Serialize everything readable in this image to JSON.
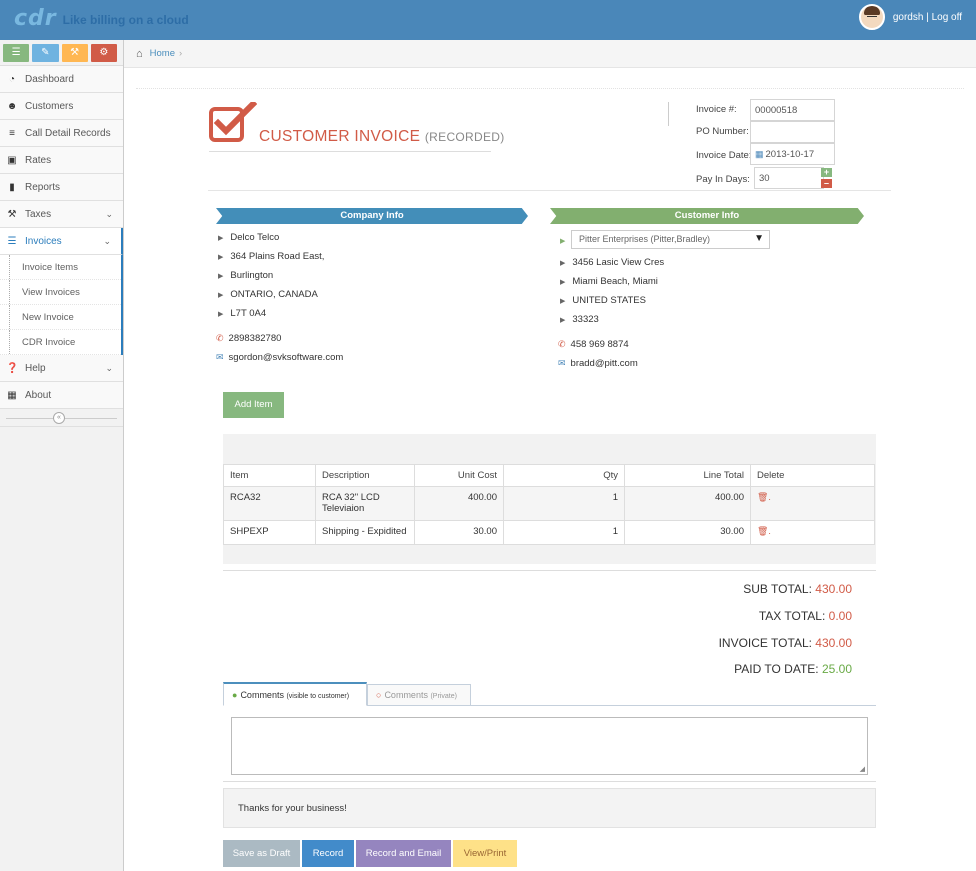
{
  "header": {
    "logo_text": "cdr",
    "tagline": "Like billing on a cloud",
    "username": "gordsh",
    "separator": "|",
    "logoff": "Log off"
  },
  "sidebar": {
    "items": [
      {
        "label": "Dashboard",
        "icon": "tachometer-icon"
      },
      {
        "label": "Customers",
        "icon": "users-icon"
      },
      {
        "label": "Call Detail Records",
        "icon": "list-icon"
      },
      {
        "label": "Rates",
        "icon": "money-icon"
      },
      {
        "label": "Reports",
        "icon": "file-icon"
      },
      {
        "label": "Taxes",
        "icon": "gavel-icon"
      },
      {
        "label": "Invoices",
        "icon": "list-icon"
      },
      {
        "label": "Help",
        "icon": "question-icon"
      },
      {
        "label": "About",
        "icon": "building-icon"
      }
    ],
    "invoices_sub": [
      "Invoice Items",
      "View Invoices",
      "New Invoice",
      "CDR Invoice"
    ]
  },
  "breadcrumb": {
    "home": "Home"
  },
  "invoice": {
    "title": "CUSTOMER INVOICE",
    "status": "(RECORDED)",
    "number_label": "Invoice #:",
    "number": "00000518",
    "po_label": "PO Number:",
    "po_value": "",
    "date_label": "Invoice Date:",
    "date": "2013-10-17",
    "pay_label": "Pay In Days:",
    "pay_days": "30"
  },
  "company": {
    "heading": "Company Info",
    "name": "Delco Telco",
    "address1": "364 Plains Road East,",
    "city": "Burlington",
    "region": "ONTARIO, CANADA",
    "postal": "L7T 0A4",
    "phone": "2898382780",
    "email": "sgordon@svksoftware.com"
  },
  "customer": {
    "heading": "Customer Info",
    "selected": "Pitter Enterprises (Pitter,Bradley)",
    "address1": "3456 Lasic View Cres",
    "city": "Miami Beach, Miami",
    "country": "UNITED STATES",
    "postal": "33323",
    "phone": "458 969 8874",
    "email": "bradd@pitt.com"
  },
  "add_item_label": "Add Item",
  "table": {
    "headers": [
      "Item",
      "Description",
      "Unit Cost",
      "Qty",
      "Line Total",
      "Delete"
    ],
    "rows": [
      {
        "item": "RCA32",
        "description": "RCA 32\" LCD Televiaion",
        "unit_cost": "400.00",
        "qty": "1",
        "line_total": "400.00"
      },
      {
        "item": "SHPEXP",
        "description": "Shipping - Expidited",
        "unit_cost": "30.00",
        "qty": "1",
        "line_total": "30.00"
      }
    ]
  },
  "totals": {
    "sub_label": "SUB TOTAL:",
    "sub": "430.00",
    "tax_label": "TAX TOTAL:",
    "tax": "0.00",
    "invoice_label": "INVOICE TOTAL:",
    "invoice": "430.00",
    "paid_label": "PAID TO DATE:",
    "paid": "25.00"
  },
  "comments": {
    "tab1": "Comments",
    "tab1_note": "(visible to customer)",
    "tab2": "Comments",
    "tab2_note": "(Private)",
    "footer_text": "Thanks for your business!"
  },
  "buttons": {
    "draft": "Save as Draft",
    "record": "Record",
    "record_email": "Record and Email",
    "view_print": "View/Print"
  }
}
